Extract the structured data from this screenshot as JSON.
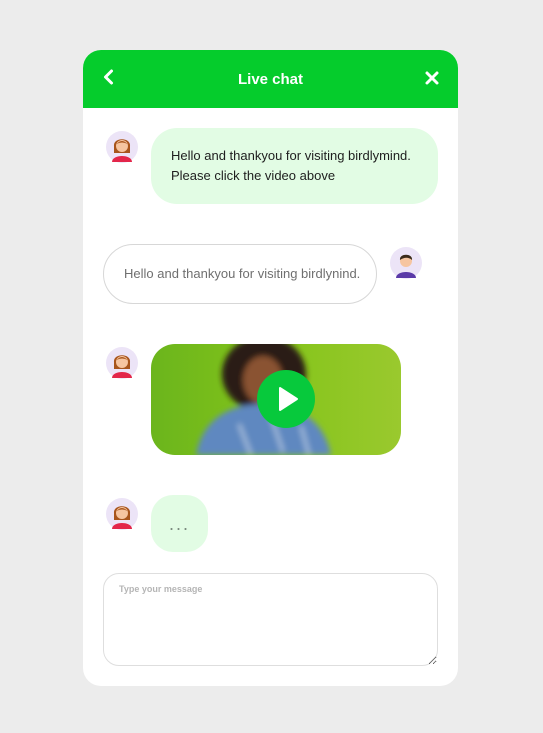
{
  "header": {
    "title": "Live chat",
    "background": "#05cc2c"
  },
  "messages": [
    {
      "from": "agent",
      "lines": [
        "Hello and thankyou for visiting birdlymind.",
        "Please click the video above"
      ]
    },
    {
      "from": "user",
      "text": "Hello and thankyou for visiting birdlynind."
    },
    {
      "from": "agent",
      "type": "video"
    },
    {
      "from": "agent",
      "type": "typing",
      "text": "..."
    }
  ],
  "composer": {
    "placeholder": "Type your message",
    "value": ""
  },
  "icons": {
    "back": "chevron-left-icon",
    "close": "close-icon",
    "play": "play-icon",
    "agent_avatar": "female-avatar",
    "user_avatar": "male-avatar"
  },
  "colors": {
    "accent": "#05cc2c",
    "agent_bubble": "#e2fce4",
    "page_background": "#ececec"
  }
}
